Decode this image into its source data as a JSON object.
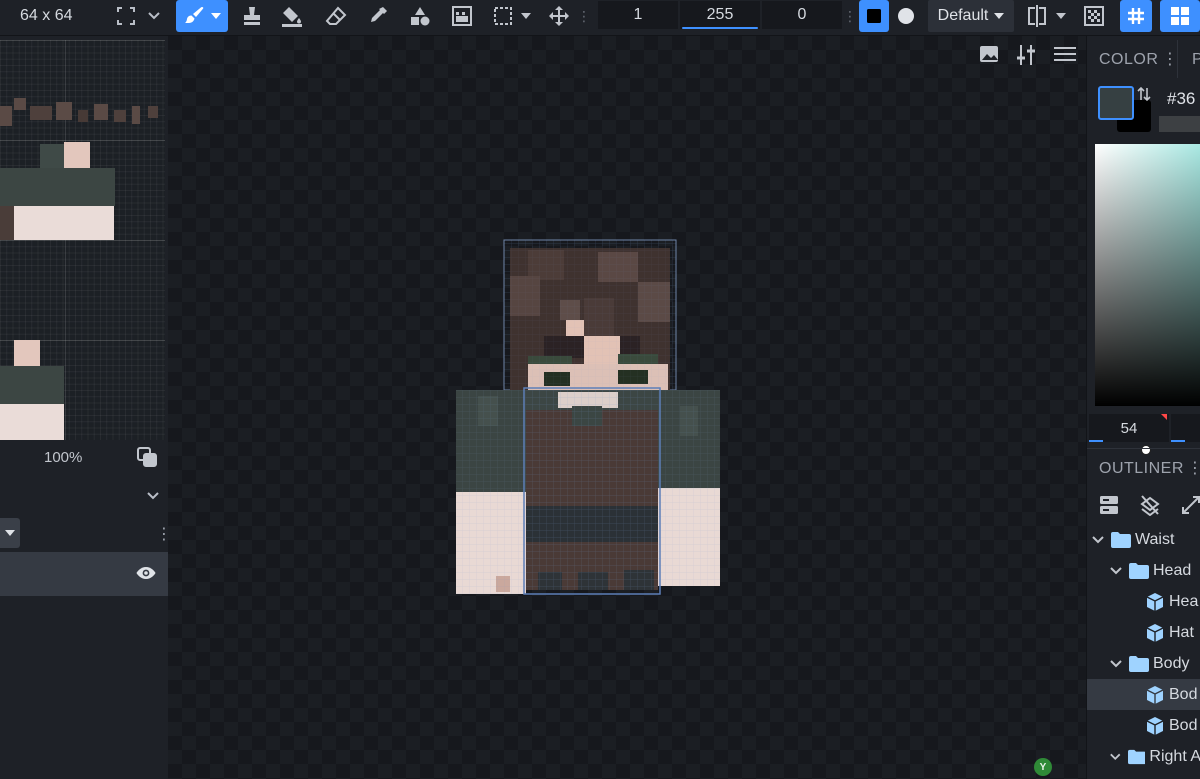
{
  "toolbar": {
    "resolution": "64 x 64",
    "opacity": "1",
    "brush_value": "255",
    "third_value": "0",
    "blend_mode": "Default"
  },
  "left_panel": {
    "zoom": "100%"
  },
  "color_panel": {
    "title": "COLOR",
    "tab2": "P",
    "hex": "#36",
    "primary_color": "#364042",
    "secondary_color": "#000000",
    "value_field": "54"
  },
  "outliner": {
    "title": "OUTLINER",
    "items": [
      {
        "label": "Waist",
        "kind": "group"
      },
      {
        "label": "Head",
        "kind": "group"
      },
      {
        "label": "Hea",
        "kind": "cube"
      },
      {
        "label": "Hat",
        "kind": "cube"
      },
      {
        "label": "Body",
        "kind": "group"
      },
      {
        "label": "Bod",
        "kind": "cube"
      },
      {
        "label": "Bod",
        "kind": "cube"
      },
      {
        "label": "Right A",
        "kind": "group"
      }
    ]
  },
  "viewport": {
    "axis_label": "Y"
  },
  "colors": {
    "accent": "#3e90ff",
    "panel": "#1e2127",
    "background": "#16181d"
  }
}
